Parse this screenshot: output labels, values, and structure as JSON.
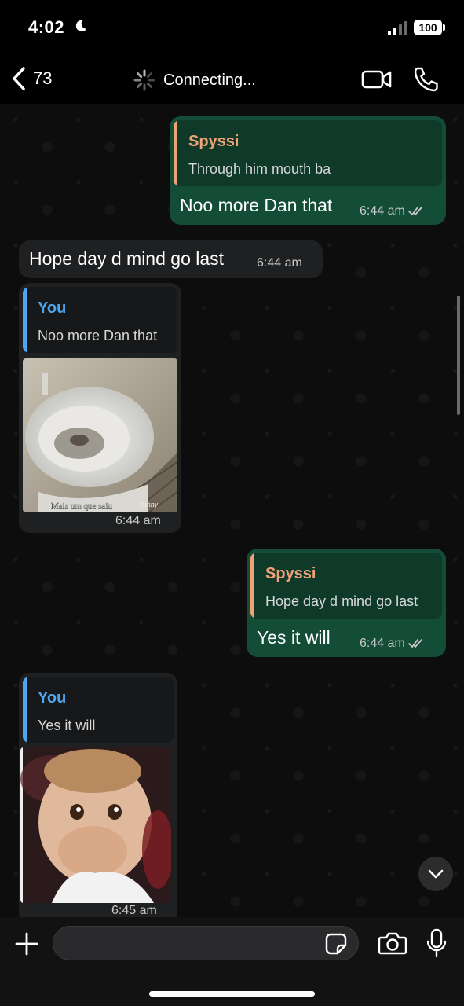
{
  "status_bar": {
    "time": "4:02",
    "battery": "100"
  },
  "header": {
    "back_count": "73",
    "status": "Connecting..."
  },
  "colors": {
    "outgoing_bubble": "#144d37",
    "incoming_bubble": "#1f2021",
    "quote_name_spyssi": "#f0a277",
    "quote_name_you": "#4fa6f0",
    "tick": "#c8c8c8"
  },
  "messages": [
    {
      "direction": "outgoing",
      "quote": {
        "author": "Spyssi",
        "text": "Through him mouth ba"
      },
      "text": "Noo more Dan that",
      "time": "6:44 am",
      "status": "read-ticks"
    },
    {
      "direction": "incoming",
      "text": "Hope day d mind go last",
      "time": "6:44 am"
    },
    {
      "direction": "incoming",
      "quote": {
        "author": "You",
        "text": "Noo more Dan that"
      },
      "media": {
        "type": "gif",
        "description": "toilet",
        "caption": "Mais um que saiu",
        "watermark": "funny"
      },
      "time": "6:44 am"
    },
    {
      "direction": "outgoing",
      "quote": {
        "author": "Spyssi",
        "text": "Hope day d mind go last"
      },
      "text": "Yes it will",
      "time": "6:44 am",
      "status": "read-ticks"
    },
    {
      "direction": "incoming",
      "quote": {
        "author": "You",
        "text": "Yes it will"
      },
      "media": {
        "type": "gif",
        "description": "laughing baby"
      },
      "time": "6:45 am"
    }
  ],
  "composer": {
    "placeholder": ""
  }
}
